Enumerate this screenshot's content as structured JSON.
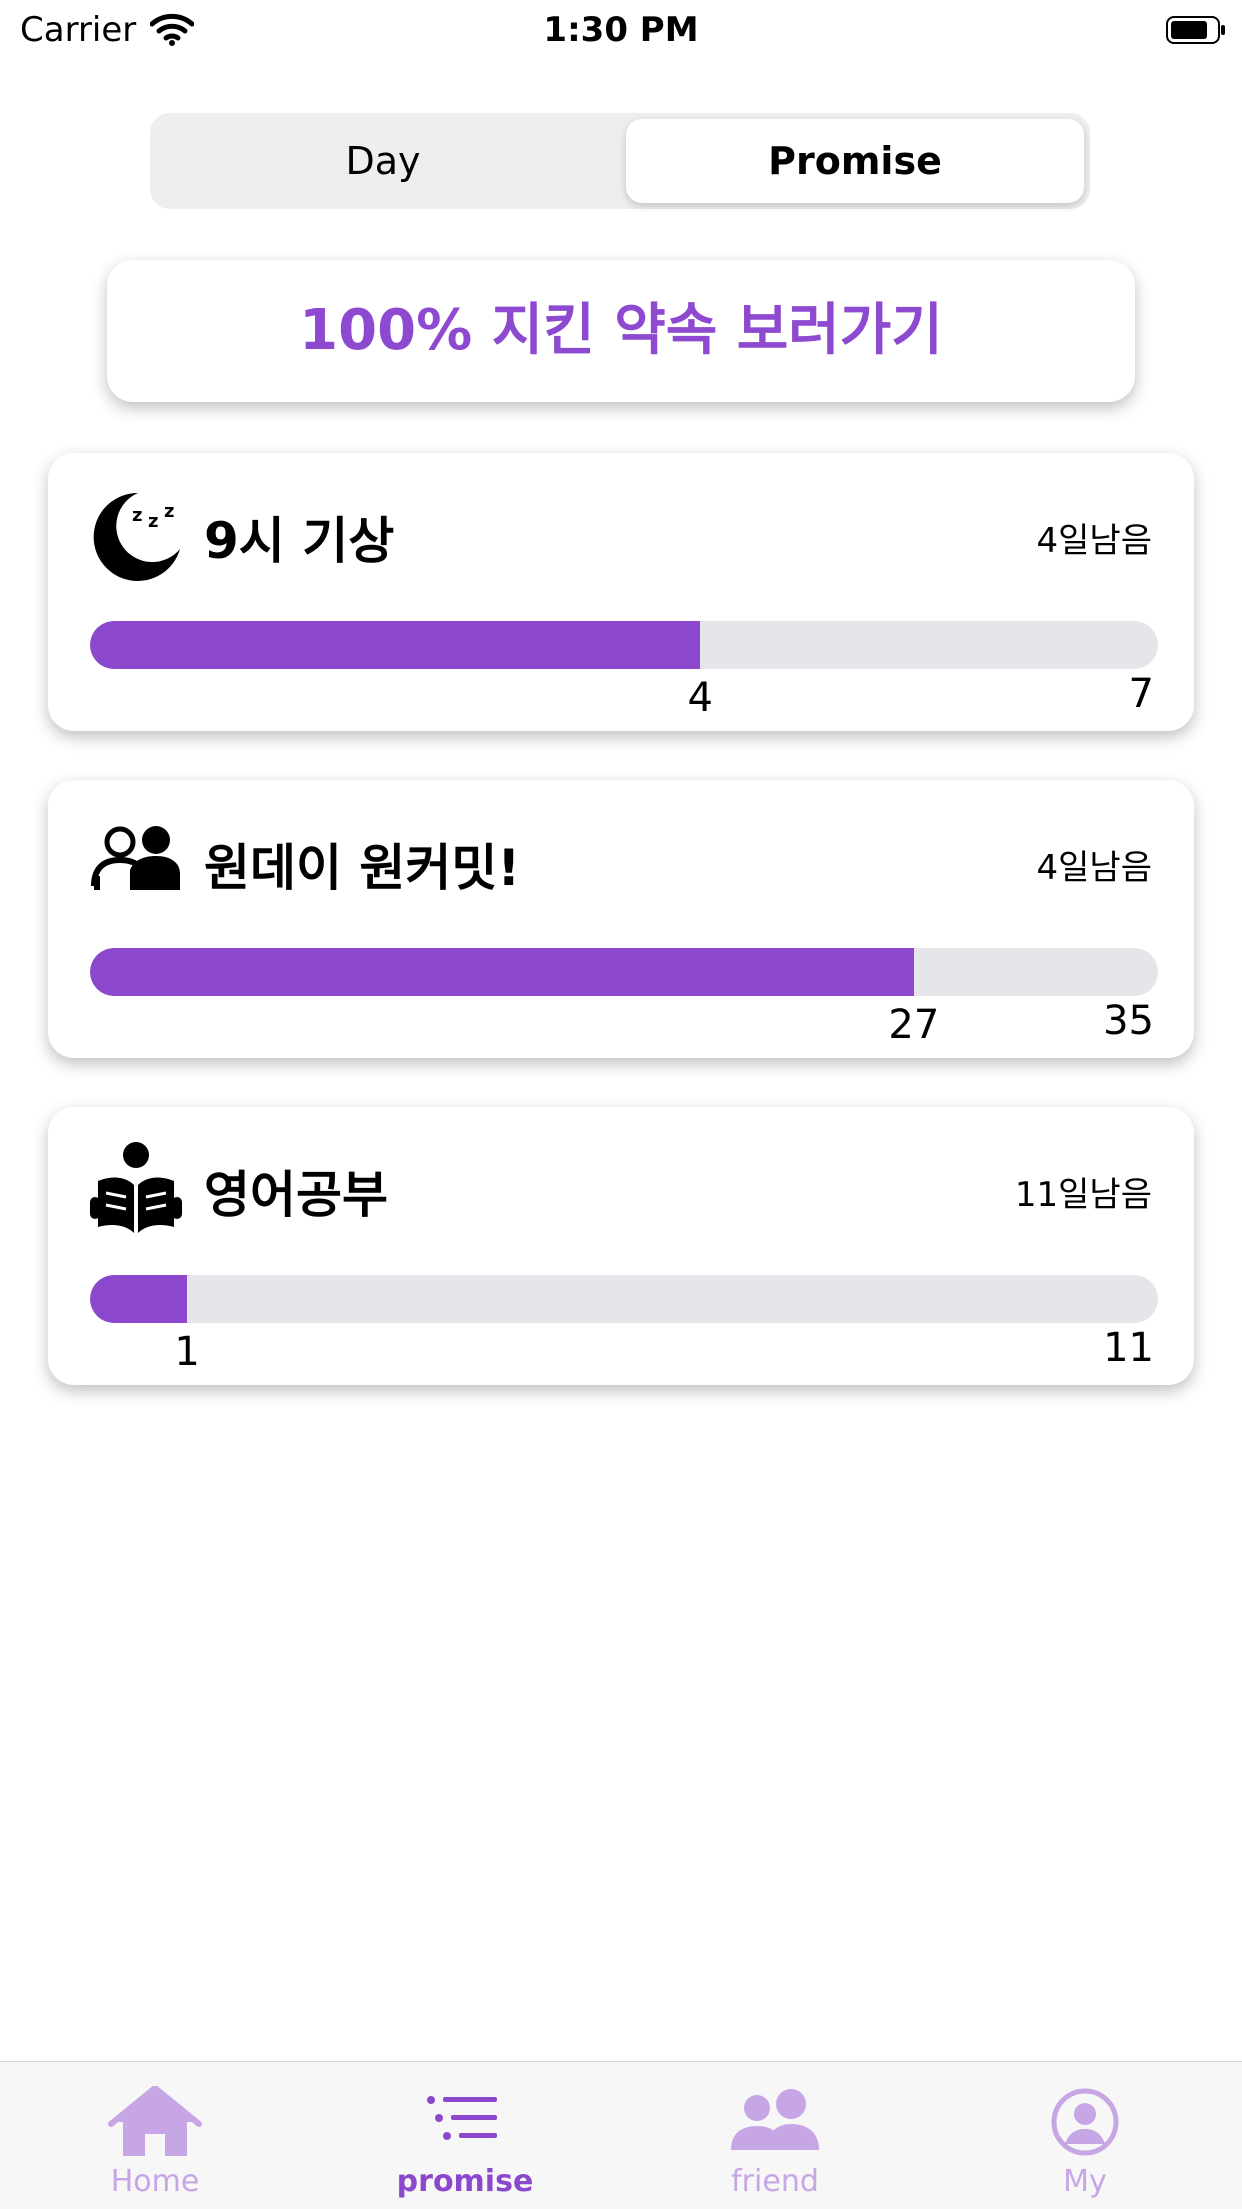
{
  "status_bar": {
    "carrier": "Carrier",
    "time": "1:30 PM"
  },
  "segmented": {
    "day_label": "Day",
    "promise_label": "Promise",
    "selected": "Promise"
  },
  "cta": {
    "label": "100% 지킨 약속 보러가기"
  },
  "promises": [
    {
      "icon": "sleeping-moon-icon",
      "title": "9시 기상",
      "days_left": "4일남음",
      "current": 4,
      "current_label": "4",
      "total": 7,
      "total_label": "7",
      "progress": 0.571
    },
    {
      "icon": "two-people-icon",
      "title": "원데이 원커밋!",
      "days_left": "4일남음",
      "current": 27,
      "current_label": "27",
      "total": 35,
      "total_label": "35",
      "progress": 0.771
    },
    {
      "icon": "reading-person-icon",
      "title": "영어공부",
      "days_left": "11일남음",
      "current": 1,
      "current_label": "1",
      "total": 11,
      "total_label": "11",
      "progress": 0.124
    }
  ],
  "tab_bar": {
    "items": [
      {
        "label": "Home",
        "icon": "house-icon",
        "active": false
      },
      {
        "label": "promise",
        "icon": "list-icon",
        "active": true
      },
      {
        "label": "friend",
        "icon": "people-icon",
        "active": false
      },
      {
        "label": "My",
        "icon": "person-circle-icon",
        "active": false
      }
    ]
  },
  "colors": {
    "accent": "#8b48cd",
    "accent_light": "#c7a6e6",
    "track": "#e5e5ea"
  }
}
